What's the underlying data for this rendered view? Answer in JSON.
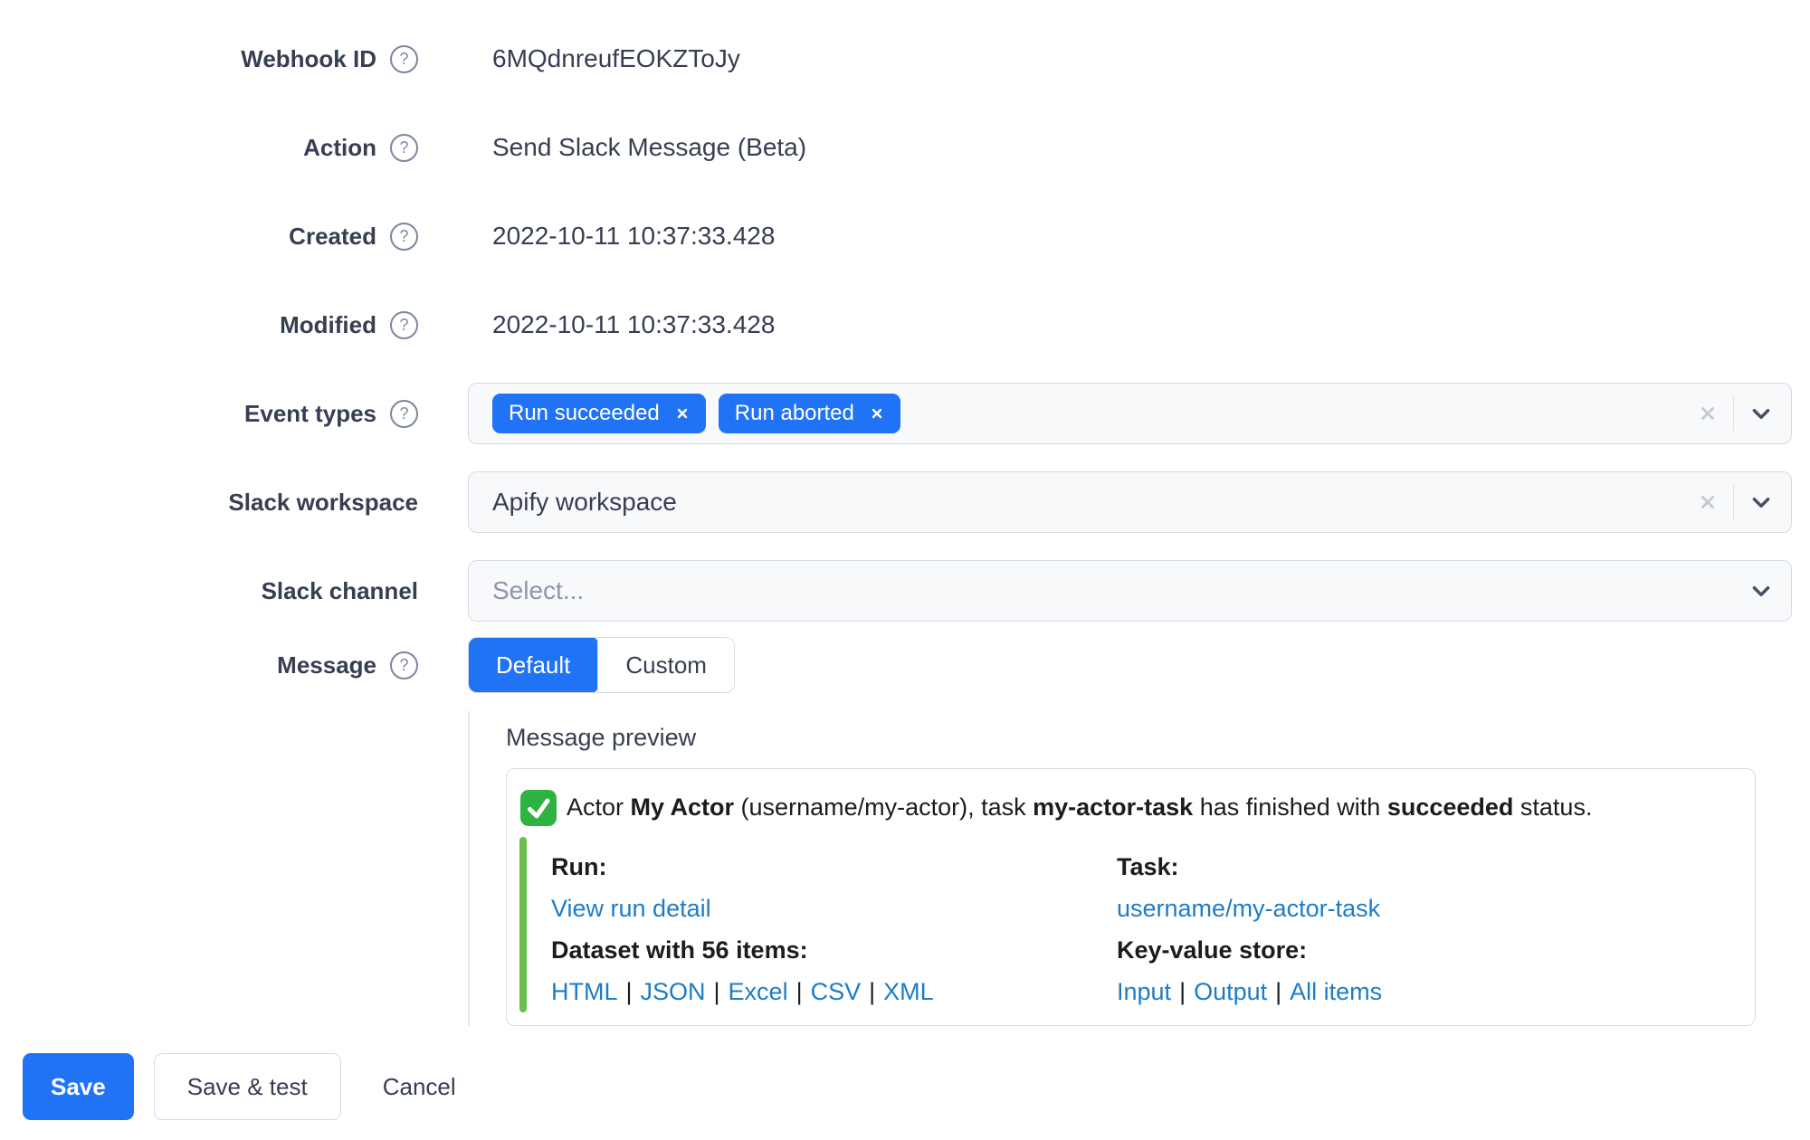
{
  "colors": {
    "accent": "#2173f5",
    "link_blue": "#1d7cc7",
    "attachment_green": "#6abf4e",
    "emoji_green": "#2eb342"
  },
  "icons": {
    "help": "?",
    "remove_tag": "close-x-icon",
    "clear_select": "close-x-icon",
    "dropdown": "chevron-down-icon",
    "status_emoji": "white-check-mark-icon"
  },
  "form": {
    "webhook_id": {
      "label": "Webhook ID",
      "value": "6MQdnreufEOKZToJy"
    },
    "action": {
      "label": "Action",
      "value": "Send Slack Message (Beta)"
    },
    "created": {
      "label": "Created",
      "value": "2022-10-11 10:37:33.428"
    },
    "modified": {
      "label": "Modified",
      "value": "2022-10-11 10:37:33.428"
    },
    "event_types": {
      "label": "Event types",
      "tags": [
        "Run succeeded",
        "Run aborted"
      ]
    },
    "slack_workspace": {
      "label": "Slack workspace",
      "value": "Apify workspace"
    },
    "slack_channel": {
      "label": "Slack channel",
      "placeholder": "Select..."
    },
    "message": {
      "label": "Message",
      "options": [
        "Default",
        "Custom"
      ],
      "selected": "Default"
    }
  },
  "preview": {
    "heading": "Message preview",
    "separator": "|",
    "title": [
      {
        "text": "Actor ",
        "bold": false
      },
      {
        "text": "My Actor",
        "bold": true
      },
      {
        "text": " (username/my-actor), task ",
        "bold": false
      },
      {
        "text": "my-actor-task",
        "bold": true
      },
      {
        "text": " has finished with ",
        "bold": false
      },
      {
        "text": "succeeded",
        "bold": true
      },
      {
        "text": " status.",
        "bold": false
      }
    ],
    "columns": [
      {
        "sections": [
          {
            "heading": "Run:",
            "links": [
              "View run detail"
            ]
          },
          {
            "heading": "Dataset with 56 items:",
            "links": [
              "HTML",
              "JSON",
              "Excel",
              "CSV",
              "XML"
            ]
          }
        ]
      },
      {
        "sections": [
          {
            "heading": "Task:",
            "links": [
              "username/my-actor-task"
            ]
          },
          {
            "heading": "Key-value store:",
            "links": [
              "Input",
              "Output",
              "All items"
            ]
          }
        ]
      }
    ]
  },
  "actions": {
    "save": "Save",
    "save_and_test": "Save & test",
    "cancel": "Cancel"
  }
}
